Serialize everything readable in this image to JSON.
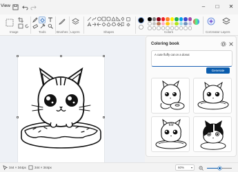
{
  "titlebar": {
    "menu_label": "View"
  },
  "ribbon": {
    "groups": {
      "image": "Image",
      "tools": "Tools",
      "brushes": "Brushes",
      "layers": "Layers",
      "shapes": "Shapes",
      "colors": "Colors",
      "cocreator": "CoCreator",
      "layers2": "Layers"
    },
    "palette": [
      "#000000",
      "#7f7f7f",
      "#880015",
      "#ed1c24",
      "#ff7f27",
      "#fff200",
      "#22b14c",
      "#00a2e8",
      "#3f48cc",
      "#a349a4",
      "#ffffff",
      "#c3c3c3",
      "#b97a57",
      "#ffaec9",
      "#ffc90e",
      "#efe4b0",
      "#b5e61d",
      "#99d9ea",
      "#7092be",
      "#c8bfe7"
    ],
    "primary_color": "#000000",
    "accent": "#0a5cad"
  },
  "panel": {
    "title": "Coloring book",
    "prompt_text": "A cute fluffy cat on a donut",
    "generate_label": "Generate",
    "settings_icon": "gear-icon",
    "close_icon": "close-icon"
  },
  "statusbar": {
    "selection_size": "344 × 344px",
    "canvas_size": "344 × 344px",
    "zoom": "60%",
    "zoom_fraction": 0.5
  }
}
